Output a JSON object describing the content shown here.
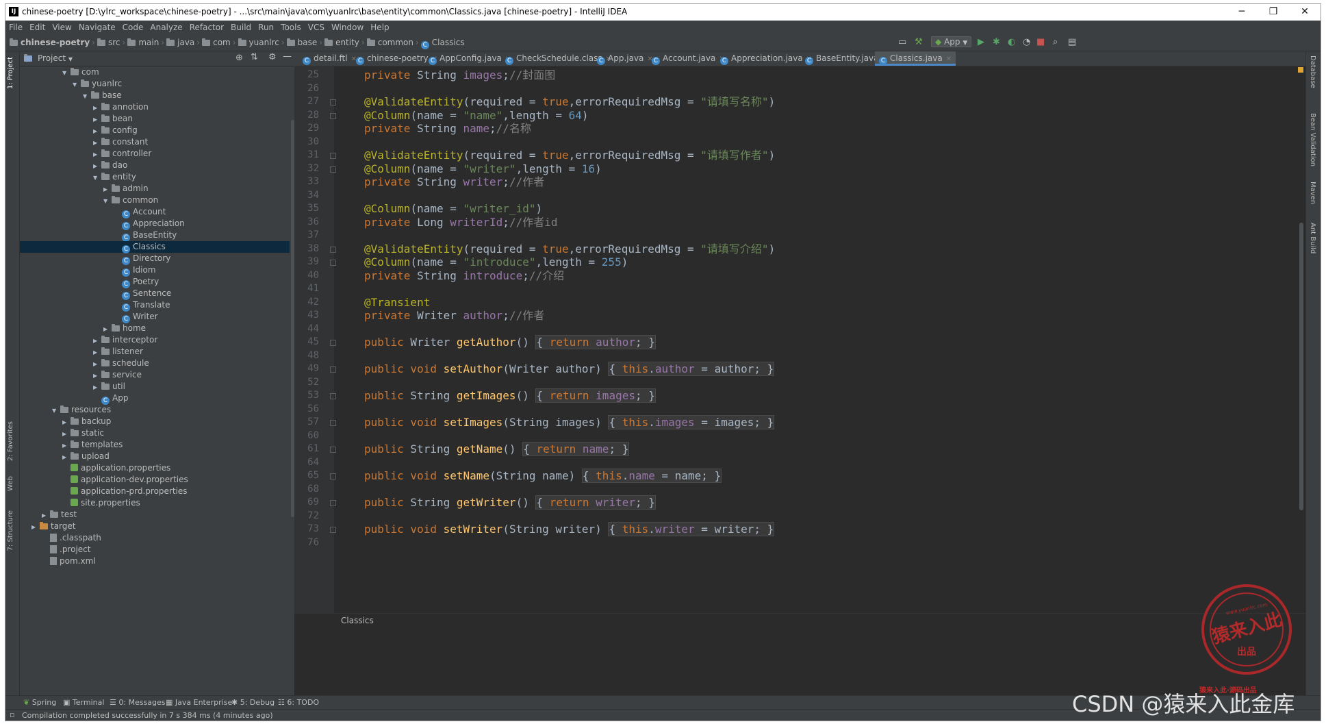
{
  "window": {
    "title": "chinese-poetry [D:\\ylrc_workspace\\chinese-poetry] - ...\\src\\main\\java\\com\\yuanlrc\\base\\entity\\common\\Classics.java [chinese-poetry] - IntelliJ IDEA",
    "minimize": "─",
    "restore": "❐",
    "close": "✕"
  },
  "menu": [
    "File",
    "Edit",
    "View",
    "Navigate",
    "Code",
    "Analyze",
    "Refactor",
    "Build",
    "Run",
    "Tools",
    "VCS",
    "Window",
    "Help"
  ],
  "breadcrumb": [
    "chinese-poetry",
    "src",
    "main",
    "java",
    "com",
    "yuanlrc",
    "base",
    "entity",
    "common",
    "Classics"
  ],
  "run_config": "App",
  "project_panel": {
    "title": "Project",
    "tree": [
      {
        "label": "com",
        "depth": 0,
        "type": "folder",
        "state": "open"
      },
      {
        "label": "yuanlrc",
        "depth": 1,
        "type": "folder",
        "state": "open"
      },
      {
        "label": "base",
        "depth": 2,
        "type": "folder",
        "state": "open"
      },
      {
        "label": "annotion",
        "depth": 3,
        "type": "folder",
        "state": "closed"
      },
      {
        "label": "bean",
        "depth": 3,
        "type": "folder",
        "state": "closed"
      },
      {
        "label": "config",
        "depth": 3,
        "type": "folder",
        "state": "closed"
      },
      {
        "label": "constant",
        "depth": 3,
        "type": "folder",
        "state": "closed"
      },
      {
        "label": "controller",
        "depth": 3,
        "type": "folder",
        "state": "closed"
      },
      {
        "label": "dao",
        "depth": 3,
        "type": "folder",
        "state": "closed"
      },
      {
        "label": "entity",
        "depth": 3,
        "type": "folder",
        "state": "open"
      },
      {
        "label": "admin",
        "depth": 4,
        "type": "folder",
        "state": "closed"
      },
      {
        "label": "common",
        "depth": 4,
        "type": "folder",
        "state": "open"
      },
      {
        "label": "Account",
        "depth": 5,
        "type": "class"
      },
      {
        "label": "Appreciation",
        "depth": 5,
        "type": "class"
      },
      {
        "label": "BaseEntity",
        "depth": 5,
        "type": "class"
      },
      {
        "label": "Classics",
        "depth": 5,
        "type": "class",
        "selected": true
      },
      {
        "label": "Directory",
        "depth": 5,
        "type": "class"
      },
      {
        "label": "Idiom",
        "depth": 5,
        "type": "class"
      },
      {
        "label": "Poetry",
        "depth": 5,
        "type": "class"
      },
      {
        "label": "Sentence",
        "depth": 5,
        "type": "class"
      },
      {
        "label": "Translate",
        "depth": 5,
        "type": "class"
      },
      {
        "label": "Writer",
        "depth": 5,
        "type": "class"
      },
      {
        "label": "home",
        "depth": 4,
        "type": "folder",
        "state": "closed"
      },
      {
        "label": "interceptor",
        "depth": 3,
        "type": "folder",
        "state": "closed"
      },
      {
        "label": "listener",
        "depth": 3,
        "type": "folder",
        "state": "closed"
      },
      {
        "label": "schedule",
        "depth": 3,
        "type": "folder",
        "state": "closed"
      },
      {
        "label": "service",
        "depth": 3,
        "type": "folder",
        "state": "closed"
      },
      {
        "label": "util",
        "depth": 3,
        "type": "folder",
        "state": "closed"
      },
      {
        "label": "App",
        "depth": 3,
        "type": "class"
      },
      {
        "label": "resources",
        "depth": -1,
        "type": "folder",
        "state": "open"
      },
      {
        "label": "backup",
        "depth": 0,
        "type": "folder",
        "state": "closed"
      },
      {
        "label": "static",
        "depth": 0,
        "type": "folder",
        "state": "closed"
      },
      {
        "label": "templates",
        "depth": 0,
        "type": "folder",
        "state": "closed"
      },
      {
        "label": "upload",
        "depth": 0,
        "type": "folder",
        "state": "closed"
      },
      {
        "label": "application.properties",
        "depth": 0,
        "type": "prop"
      },
      {
        "label": "application-dev.properties",
        "depth": 0,
        "type": "prop"
      },
      {
        "label": "application-prd.properties",
        "depth": 0,
        "type": "prop"
      },
      {
        "label": "site.properties",
        "depth": 0,
        "type": "prop"
      },
      {
        "label": "test",
        "depth": -2,
        "type": "folder",
        "state": "closed"
      },
      {
        "label": "target",
        "depth": -3,
        "type": "folder-orange",
        "state": "closed"
      },
      {
        "label": ".classpath",
        "depth": -2,
        "type": "file"
      },
      {
        "label": ".project",
        "depth": -2,
        "type": "file"
      },
      {
        "label": "pom.xml",
        "depth": -2,
        "type": "file"
      }
    ]
  },
  "tabs": [
    {
      "label": "detail.ftl",
      "active": false
    },
    {
      "label": "chinese-poetry",
      "active": false
    },
    {
      "label": "AppConfig.java",
      "active": false
    },
    {
      "label": "CheckSchedule.class",
      "active": false
    },
    {
      "label": "App.java",
      "active": false
    },
    {
      "label": "Account.java",
      "active": false
    },
    {
      "label": "Appreciation.java",
      "active": false
    },
    {
      "label": "BaseEntity.java",
      "active": false
    },
    {
      "label": "Classics.java",
      "active": true
    }
  ],
  "code_lines": [
    {
      "n": "25",
      "html": "<span class='kw'>private</span> String <span class='fd'>images</span>;<span class='cm'>//封面图</span>"
    },
    {
      "n": "26",
      "html": ""
    },
    {
      "n": "27",
      "html": "<span class='an'>@ValidateEntity</span>(required = <span class='kw'>true</span>,errorRequiredMsg = <span class='st'>\"请填写名称\"</span>)",
      "fold": true
    },
    {
      "n": "28",
      "html": "<span class='an'>@Column</span>(name = <span class='st'>\"name\"</span>,length = <span class='nm'>64</span>)",
      "fold": true
    },
    {
      "n": "29",
      "html": "<span class='kw'>private</span> String <span class='fd'>name</span>;<span class='cm'>//名称</span>"
    },
    {
      "n": "30",
      "html": ""
    },
    {
      "n": "31",
      "html": "<span class='an'>@ValidateEntity</span>(required = <span class='kw'>true</span>,errorRequiredMsg = <span class='st'>\"请填写作者\"</span>)",
      "fold": true
    },
    {
      "n": "32",
      "html": "<span class='an'>@Column</span>(name = <span class='st'>\"writer\"</span>,length = <span class='nm'>16</span>)",
      "fold": true
    },
    {
      "n": "33",
      "html": "<span class='kw'>private</span> String <span class='fd'>writer</span>;<span class='cm'>//作者</span>"
    },
    {
      "n": "34",
      "html": ""
    },
    {
      "n": "35",
      "html": "<span class='an'>@Column</span>(name = <span class='st'>\"writer_id\"</span>)"
    },
    {
      "n": "36",
      "html": "<span class='kw'>private</span> Long <span class='fd'>writerId</span>;<span class='cm'>//作者id</span>"
    },
    {
      "n": "37",
      "html": ""
    },
    {
      "n": "38",
      "html": "<span class='an'>@ValidateEntity</span>(required = <span class='kw'>true</span>,errorRequiredMsg = <span class='st'>\"请填写介绍\"</span>)",
      "fold": true
    },
    {
      "n": "39",
      "html": "<span class='an'>@Column</span>(name = <span class='st'>\"introduce\"</span>,length = <span class='nm'>255</span>)",
      "fold": true
    },
    {
      "n": "40",
      "html": "<span class='kw'>private</span> String <span class='fd'>introduce</span>;<span class='cm'>//介绍</span>"
    },
    {
      "n": "41",
      "html": ""
    },
    {
      "n": "42",
      "html": "<span class='an'>@Transient</span>"
    },
    {
      "n": "43",
      "html": "<span class='kw'>private</span> Writer <span class='fd'>author</span>;<span class='cm'>//作者</span>"
    },
    {
      "n": "44",
      "html": ""
    },
    {
      "n": "45",
      "html": "<span class='kw'>public</span> Writer <span class='fn'>getAuthor</span>() <span class='fbox'>{ <span class='kw'>return</span> <span class='fd'>author</span>; }</span>",
      "fold": true
    },
    {
      "n": "48",
      "html": ""
    },
    {
      "n": "49",
      "html": "<span class='kw'>public void</span> <span class='fn'>setAuthor</span>(Writer author) <span class='fbox'>{ <span class='kw'>this</span>.<span class='fd'>author</span> = author; }</span>",
      "fold": true
    },
    {
      "n": "52",
      "html": ""
    },
    {
      "n": "53",
      "html": "<span class='kw'>public</span> String <span class='fn'>getImages</span>() <span class='fbox'>{ <span class='kw'>return</span> <span class='fd'>images</span>; }</span>",
      "fold": true
    },
    {
      "n": "56",
      "html": ""
    },
    {
      "n": "57",
      "html": "<span class='kw'>public void</span> <span class='fn'>setImages</span>(String images) <span class='fbox'>{ <span class='kw'>this</span>.<span class='fd'>images</span> = images; }</span>",
      "fold": true
    },
    {
      "n": "60",
      "html": ""
    },
    {
      "n": "61",
      "html": "<span class='kw'>public</span> String <span class='fn'>getName</span>() <span class='fbox'>{ <span class='kw'>return</span> <span class='fd'>name</span>; }</span>",
      "fold": true
    },
    {
      "n": "64",
      "html": ""
    },
    {
      "n": "65",
      "html": "<span class='kw'>public void</span> <span class='fn'>setName</span>(String name) <span class='fbox'>{ <span class='kw'>this</span>.<span class='fd'>name</span> = name; }</span>",
      "fold": true
    },
    {
      "n": "68",
      "html": ""
    },
    {
      "n": "69",
      "html": "<span class='kw'>public</span> String <span class='fn'>getWriter</span>() <span class='fbox'>{ <span class='kw'>return</span> <span class='fd'>writer</span>; }</span>",
      "fold": true
    },
    {
      "n": "72",
      "html": ""
    },
    {
      "n": "73",
      "html": "<span class='kw'>public void</span> <span class='fn'>setWriter</span>(String writer) <span class='fbox'>{ <span class='kw'>this</span>.<span class='fd'>writer</span> = writer; }</span>",
      "fold": true
    },
    {
      "n": "76",
      "html": ""
    }
  ],
  "editor_breadcrumb": "Classics",
  "left_tool_tabs": [
    "1: Project",
    "2: Favorites",
    "Web",
    "7: Structure"
  ],
  "right_tool_tabs": [
    "Database",
    "Bean Validation",
    "Maven",
    "Ant Build"
  ],
  "tool_windows": [
    "Spring",
    "Terminal",
    "0: Messages",
    "Java Enterprise",
    "5: Debug",
    "6: TODO"
  ],
  "status": "Compilation completed successfully in 7 s 384 ms (4 minutes ago)",
  "watermark": "CSDN @猿来入此金库",
  "stamp": {
    "main": "猿来入此",
    "sub": "出品",
    "url": "www.yuanlrc.com",
    "note": "猿来入此·源码出品"
  }
}
